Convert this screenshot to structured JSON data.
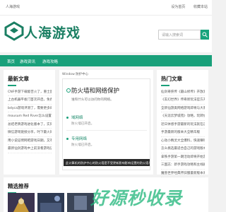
{
  "topbar": {
    "site": "人海游戏",
    "links": [
      "设为首页",
      "收藏本站"
    ]
  },
  "brand": {
    "name": "人海游戏",
    "accent": "#19a07a"
  },
  "search": {
    "placeholder": "请输入搜索词"
  },
  "nav": {
    "items": [
      "首页",
      "游戏资讯",
      "游戏攻略"
    ]
  },
  "latest": {
    "title": "最新文章",
    "items": [
      "CNF手游下载能否火了，重士面具的...",
      "上古机器平板门首次开启，免费体验...",
      "bdyca游戏评测了，需要更多的资源...",
      "mousum Red River怎么设置中文...",
      "总结老牌游戏进化版本了，实际现在...",
      "微信游戏链接分享，时下最火的游戏...",
      "用小说证明网吧游戏日期，又有一个好...",
      "最新仙剑游戏中上前没看游戏该怎么..."
    ]
  },
  "article": {
    "breadcrumb": "Window 防护中心",
    "title": "防火墙和网络保护",
    "desc": "谁和什么可以访问你的网络。",
    "subs": [
      {
        "name": "域网络",
        "desc": "防火墙已开启。"
      },
      {
        "name": "专用网络",
        "desc": "防火墙已开启。"
      }
    ],
    "tooltip": "此计算机的防护中心的防火墙是不受更新影响影响设置的防火墙与其他系统防护已启用。"
  },
  "hot": {
    "title": "热门文章",
    "items": [
      "仙剑奇侠传《最山修传》开放测试开启了",
      "《玄幻世界》传奇新玩法官方开启",
      "全新仙游类网络游戏即将与大家见面了",
      "《天涯云梦城苑》攻略，玩转仙侠世界",
      "近日体感手游最新的玩法就在这里了",
      "手游最新的版本大全精华版",
      "心动小精灵大全爆料，快速赚钱攻略",
      "怎么挑选最适合自己的游戏版本",
      "拿铁手游第一期活动即将开始游戏公告",
      "三国志：新手游戏攻略和主线剧情",
      "魔兽世界经典怀旧服最新版本来了"
    ]
  },
  "featured": {
    "title": "精选推荐"
  },
  "watermark": "好源秒收录"
}
